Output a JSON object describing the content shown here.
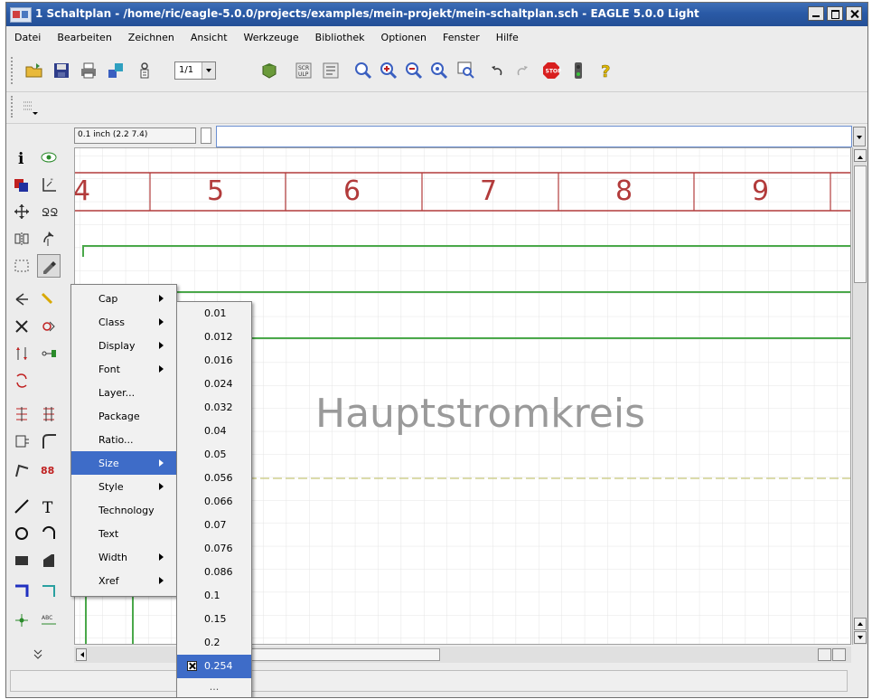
{
  "window": {
    "title": "1 Schaltplan - /home/ric/eagle-5.0.0/projects/examples/mein-projekt/mein-schaltplan.sch - EAGLE 5.0.0 Light"
  },
  "menubar": [
    "Datei",
    "Bearbeiten",
    "Zeichnen",
    "Ansicht",
    "Werkzeuge",
    "Bibliothek",
    "Optionen",
    "Fenster",
    "Hilfe"
  ],
  "toolbar": {
    "grid_select_value": "1/1"
  },
  "coordinate_display": "0.1 inch (2.2 7.4)",
  "command_line_value": "",
  "canvas": {
    "frame_columns": [
      "4",
      "5",
      "6",
      "7",
      "8",
      "9"
    ],
    "text_label": "Hauptstromkreis",
    "frame_color": "#b23b3b",
    "wire_color": "#4aa84a",
    "text_color": "#9a9a9a"
  },
  "context_menu": {
    "items": [
      {
        "label": "Cap",
        "submenu": true
      },
      {
        "label": "Class",
        "submenu": true
      },
      {
        "label": "Display",
        "submenu": true
      },
      {
        "label": "Font",
        "submenu": true
      },
      {
        "label": "Layer...",
        "submenu": false
      },
      {
        "label": "Package",
        "submenu": false
      },
      {
        "label": "Ratio...",
        "submenu": false
      },
      {
        "label": "Size",
        "submenu": true,
        "active": true
      },
      {
        "label": "Style",
        "submenu": true
      },
      {
        "label": "Technology",
        "submenu": false
      },
      {
        "label": "Text",
        "submenu": false
      },
      {
        "label": "Width",
        "submenu": true
      },
      {
        "label": "Xref",
        "submenu": true
      }
    ]
  },
  "size_submenu": {
    "items": [
      "0.01",
      "0.012",
      "0.016",
      "0.024",
      "0.032",
      "0.04",
      "0.05",
      "0.056",
      "0.066",
      "0.07",
      "0.076",
      "0.086",
      "0.1",
      "0.15",
      "0.2",
      "0.254"
    ],
    "checked": "0.254",
    "more": "..."
  },
  "colors": {
    "titlebar": "#2a5aa6",
    "selection": "#3e6cc8"
  }
}
